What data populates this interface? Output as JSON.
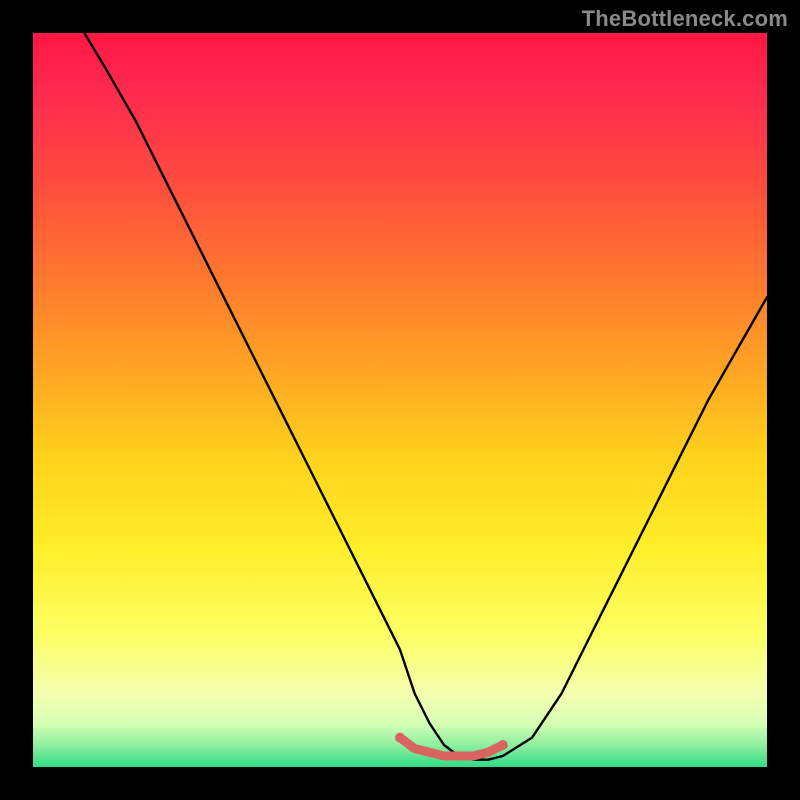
{
  "attribution": "TheBottleneck.com",
  "chart_data": {
    "type": "line",
    "title": "",
    "xlabel": "",
    "ylabel": "",
    "xlim": [
      0,
      100
    ],
    "ylim": [
      0,
      100
    ],
    "series": [
      {
        "name": "bottleneck-curve",
        "x": [
          7,
          10,
          14,
          18,
          22,
          26,
          30,
          34,
          38,
          42,
          46,
          50,
          52,
          54,
          56,
          58,
          60,
          62,
          64,
          68,
          72,
          76,
          80,
          84,
          88,
          92,
          96,
          100
        ],
        "y": [
          100,
          95,
          88,
          80,
          72,
          64,
          56,
          48,
          40,
          32,
          24,
          16,
          10,
          6,
          3,
          1.5,
          1,
          1,
          1.5,
          4,
          10,
          18,
          26,
          34,
          42,
          50,
          57,
          64
        ]
      },
      {
        "name": "highlight-bottom",
        "x": [
          50,
          52,
          54,
          56,
          58,
          60,
          62,
          64
        ],
        "y": [
          4,
          2.5,
          2,
          1.5,
          1.5,
          1.5,
          2,
          3
        ]
      }
    ],
    "highlight_color": "#d9645f",
    "curve_color": "#000000"
  }
}
